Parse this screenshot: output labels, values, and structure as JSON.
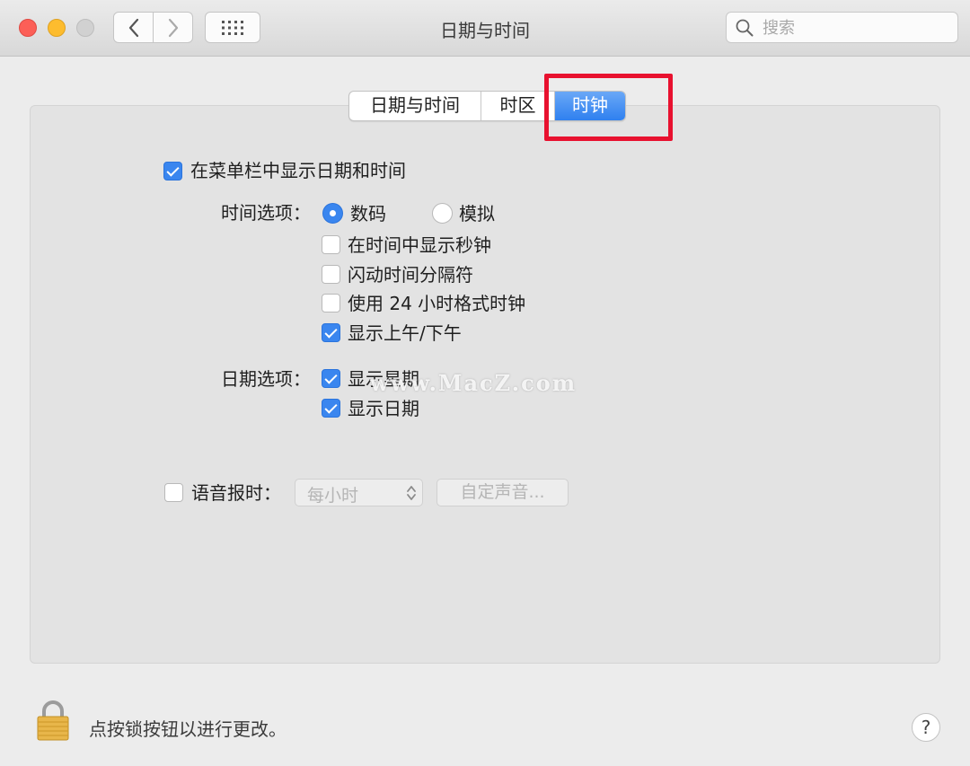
{
  "window": {
    "title": "日期与时间"
  },
  "search": {
    "placeholder": "搜索"
  },
  "tabs": [
    {
      "label": "日期与时间",
      "active": false
    },
    {
      "label": "时区",
      "active": false
    },
    {
      "label": "时钟",
      "active": true
    }
  ],
  "clock": {
    "show_in_menubar": {
      "label": "在菜单栏中显示日期和时间",
      "checked": true
    },
    "time_options": {
      "label": "时间选项：",
      "radio_digital": {
        "label": "数码",
        "selected": true
      },
      "radio_analog": {
        "label": "模拟",
        "selected": false
      },
      "show_seconds": {
        "label": "在时间中显示秒钟",
        "checked": false
      },
      "flash_separators": {
        "label": "闪动时间分隔符",
        "checked": false
      },
      "use_24h": {
        "label": "使用 24 小时格式时钟",
        "checked": false
      },
      "show_ampm": {
        "label": "显示上午/下午",
        "checked": true
      }
    },
    "date_options": {
      "label": "日期选项：",
      "show_weekday": {
        "label": "显示星期",
        "checked": true
      },
      "show_date": {
        "label": "显示日期",
        "checked": true
      }
    },
    "announce": {
      "label": "语音报时：",
      "checked": false,
      "interval": "每小时",
      "custom_voice_label": "自定声音..."
    }
  },
  "watermark": "www.MacZ.com",
  "footer": {
    "lock_message": "点按锁按钮以进行更改。",
    "help_label": "?"
  },
  "colors": {
    "accent": "#3a86ef",
    "highlight_box": "#e8112f"
  }
}
